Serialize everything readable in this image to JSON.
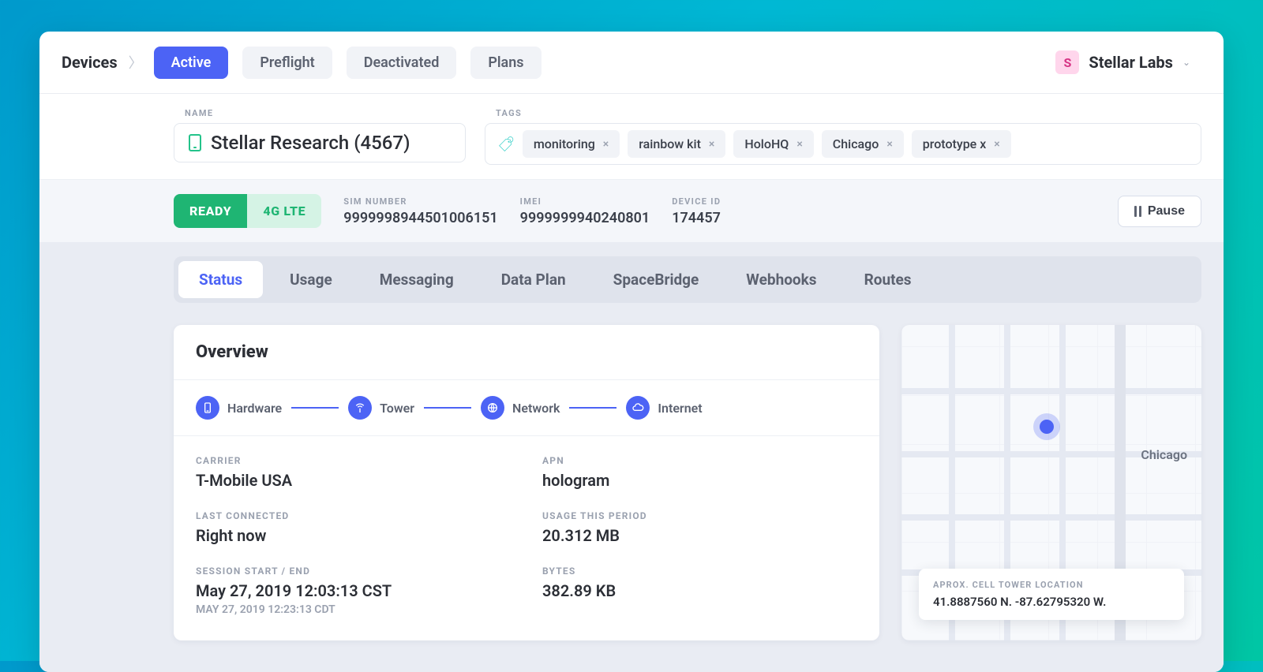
{
  "header": {
    "breadcrumb_root": "Devices",
    "tabs": [
      {
        "label": "Active",
        "active": true
      },
      {
        "label": "Preflight",
        "active": false
      },
      {
        "label": "Deactivated",
        "active": false
      },
      {
        "label": "Plans",
        "active": false
      }
    ],
    "org": {
      "initial": "S",
      "name": "Stellar Labs"
    }
  },
  "device": {
    "name_label": "NAME",
    "name": "Stellar Research (4567)",
    "tags_label": "TAGS",
    "tags": [
      "monitoring",
      "rainbow kit",
      "HoloHQ",
      "Chicago",
      "prototype x"
    ]
  },
  "status_strip": {
    "ready_label": "READY",
    "network_label": "4G LTE",
    "sim_label": "SIM NUMBER",
    "sim_value": "9999998944501006151",
    "imei_label": "IMEI",
    "imei_value": "9999999940240801",
    "device_id_label": "DEVICE ID",
    "device_id_value": "174457",
    "pause_label": "Pause"
  },
  "subtabs": [
    {
      "label": "Status",
      "active": true
    },
    {
      "label": "Usage",
      "active": false
    },
    {
      "label": "Messaging",
      "active": false
    },
    {
      "label": "Data Plan",
      "active": false
    },
    {
      "label": "SpaceBridge",
      "active": false
    },
    {
      "label": "Webhooks",
      "active": false
    },
    {
      "label": "Routes",
      "active": false
    }
  ],
  "overview": {
    "title": "Overview",
    "path": [
      "Hardware",
      "Tower",
      "Network",
      "Internet"
    ],
    "carrier_label": "CARRIER",
    "carrier_value": "T-Mobile USA",
    "apn_label": "APN",
    "apn_value": "hologram",
    "last_connected_label": "LAST CONNECTED",
    "last_connected_value": "Right now",
    "usage_label": "USAGE THIS PERIOD",
    "usage_value": "20.312 MB",
    "session_label": "SESSION START / END",
    "session_start": "May 27, 2019  12:03:13 CST",
    "session_end": "MAY 27, 2019  12:23:13 CDT",
    "bytes_label": "BYTES",
    "bytes_value": "382.89 KB"
  },
  "map": {
    "city_label": "Chicago",
    "badge_title": "APROX. CELL TOWER LOCATION",
    "coords": "41.8887560 N. -87.62795320 W."
  }
}
